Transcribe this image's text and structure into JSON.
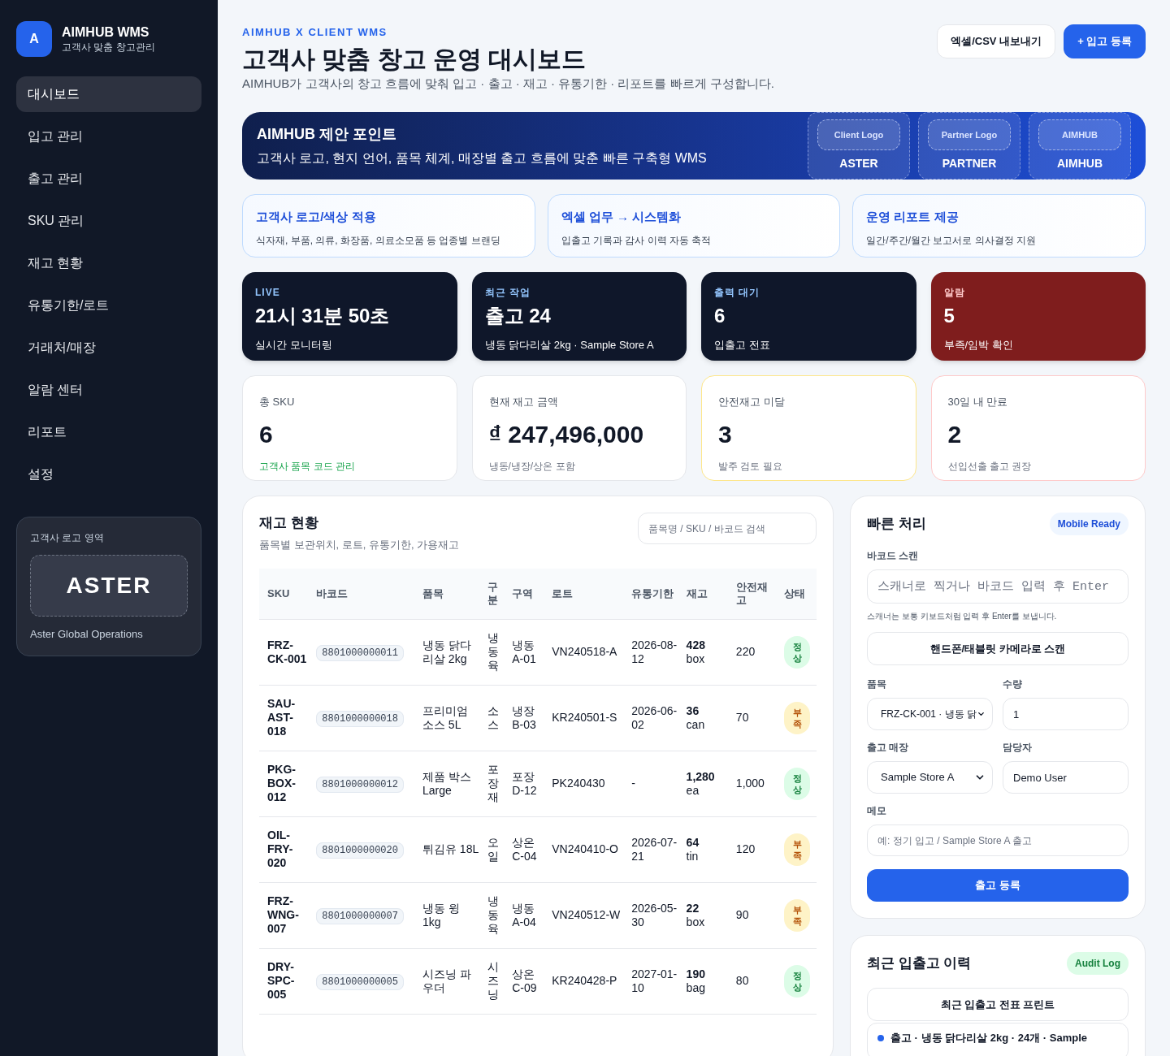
{
  "brand": {
    "mark": "A",
    "name": "AIMHUB WMS",
    "subtitle": "고객사 맞춤 창고관리"
  },
  "sidebar": {
    "items": [
      {
        "label": "대시보드",
        "selected": true
      },
      {
        "label": "입고 관리",
        "selected": false
      },
      {
        "label": "출고 관리",
        "selected": false
      },
      {
        "label": "SKU 관리",
        "selected": false
      },
      {
        "label": "재고 현황",
        "selected": false
      },
      {
        "label": "유통기한/로트",
        "selected": false
      },
      {
        "label": "거래처/매장",
        "selected": false
      },
      {
        "label": "알람 센터",
        "selected": false
      },
      {
        "label": "리포트",
        "selected": false
      },
      {
        "label": "설정",
        "selected": false
      }
    ],
    "logo_area": {
      "title": "고객사 로고 영역",
      "logo": "ASTER",
      "caption": "Aster Global Operations"
    }
  },
  "header": {
    "eyebrow": "AIMHUB X CLIENT WMS",
    "title": "고객사 맞춤 창고 운영 대시보드",
    "subtitle": "AIMHUB가 고객사의 창고 흐름에 맞춰 입고 · 출고 · 재고 · 유통기한 · 리포트를 빠르게 구성합니다.",
    "buttons": [
      {
        "label": "엑셀/CSV 내보내기",
        "kind": "secondary"
      },
      {
        "label": "+ 입고 등록",
        "kind": "primary"
      }
    ]
  },
  "banner": {
    "title": "AIMHUB 제안 포인트",
    "text": "고객사 로고, 현지 언어, 품목 체계, 매장별 출고 흐름에 맞춘 빠른 구축형 WMS",
    "logos": [
      {
        "tag": "Client Logo",
        "name": "ASTER"
      },
      {
        "tag": "Partner Logo",
        "name": "PARTNER"
      },
      {
        "tag": "AIMHUB",
        "name": "AIMHUB"
      }
    ]
  },
  "features": [
    {
      "title": "고객사 로고/색상 적용",
      "text": "식자재, 부품, 의류, 화장품, 의료소모품 등 업종별 브랜딩"
    },
    {
      "title": "엑셀 업무 → 시스템화",
      "text": "입출고 기록과 감사 이력 자동 축적"
    },
    {
      "title": "운영 리포트 제공",
      "text": "일간/주간/월간 보고서로 의사결정 지원"
    }
  ],
  "status_cards": [
    {
      "label": "LIVE",
      "value": "21시 31분 50초",
      "caption": "실시간 모니터링",
      "kind": "live"
    },
    {
      "label": "최근 작업",
      "value": "출고 24",
      "caption": "냉동 닭다리살 2kg · Sample Store A",
      "kind": "dark"
    },
    {
      "label": "출력 대기",
      "value": "6",
      "caption": "입출고 전표",
      "kind": "dark"
    },
    {
      "label": "알람",
      "value": "5",
      "caption": "부족/임박 확인",
      "kind": "alert"
    }
  ],
  "kpis": [
    {
      "label": "총 SKU",
      "value": "6",
      "caption": "고객사 품목 코드 관리",
      "kind": "good"
    },
    {
      "label": "현재 재고 금액",
      "value": "₫ 247,496,000",
      "caption": "냉동/냉장/상온 포함",
      "kind": "plain"
    },
    {
      "label": "안전재고 미달",
      "value": "3",
      "caption": "발주 검토 필요",
      "kind": "warning"
    },
    {
      "label": "30일 내 만료",
      "value": "2",
      "caption": "선입선출 출고 권장",
      "kind": "danger"
    }
  ],
  "inventory": {
    "title": "재고 현황",
    "subtitle": "품목별 보관위치, 로트, 유통기한, 가용재고",
    "search": {
      "placeholder": "품목명 / SKU / 바코드 검색"
    },
    "columns": [
      "SKU",
      "바코드",
      "품목",
      "구분",
      "구역",
      "로트",
      "유통기한",
      "재고",
      "안전재고",
      "상태"
    ],
    "rows": [
      {
        "sku": "FRZ-CK-001",
        "barcode": "8801000000011",
        "item": "냉동 닭다리살 2kg",
        "category": "냉동육",
        "zone": "냉동 A-01",
        "lot": "VN240518-A",
        "expiry": "2026-08-12",
        "stock": "428",
        "unit": "box",
        "safety": "220",
        "status": {
          "label": "정상",
          "kind": "ok"
        }
      },
      {
        "sku": "SAU-AST-018",
        "barcode": "8801000000018",
        "item": "프리미엄 소스 5L",
        "category": "소스",
        "zone": "냉장 B-03",
        "lot": "KR240501-S",
        "expiry": "2026-06-02",
        "stock": "36",
        "unit": "can",
        "safety": "70",
        "status": {
          "label": "부족",
          "kind": "low"
        }
      },
      {
        "sku": "PKG-BOX-012",
        "barcode": "8801000000012",
        "item": "제품 박스 Large",
        "category": "포장재",
        "zone": "포장 D-12",
        "lot": "PK240430",
        "expiry": "-",
        "stock": "1,280",
        "unit": "ea",
        "safety": "1,000",
        "status": {
          "label": "정상",
          "kind": "ok"
        }
      },
      {
        "sku": "OIL-FRY-020",
        "barcode": "8801000000020",
        "item": "튀김유 18L",
        "category": "오일",
        "zone": "상온 C-04",
        "lot": "VN240410-O",
        "expiry": "2026-07-21",
        "stock": "64",
        "unit": "tin",
        "safety": "120",
        "status": {
          "label": "부족",
          "kind": "low"
        }
      },
      {
        "sku": "FRZ-WNG-007",
        "barcode": "8801000000007",
        "item": "냉동 윙 1kg",
        "category": "냉동육",
        "zone": "냉동 A-04",
        "lot": "VN240512-W",
        "expiry": "2026-05-30",
        "stock": "22",
        "unit": "box",
        "safety": "90",
        "status": {
          "label": "부족",
          "kind": "low"
        }
      },
      {
        "sku": "DRY-SPC-005",
        "barcode": "8801000000005",
        "item": "시즈닝 파우더",
        "category": "시즈닝",
        "zone": "상온 C-09",
        "lot": "KR240428-P",
        "expiry": "2027-01-10",
        "stock": "190",
        "unit": "bag",
        "safety": "80",
        "status": {
          "label": "정상",
          "kind": "ok"
        }
      }
    ]
  },
  "quick": {
    "title": "빠른 처리",
    "badge": "Mobile Ready",
    "scan_label": "바코드 스캔",
    "scan": {
      "placeholder": "스캐너로 찍거나 바코드 입력 후 Enter"
    },
    "scan_hint": "스캐너는 보통 키보드처럼 입력 후 Enter를 보냅니다.",
    "camera_button": "핸드폰/태블릿 카메라로 스캔",
    "item_label": "품목",
    "item_value": "FRZ-CK-001 · 냉동 닭",
    "qty_label": "수량",
    "qty_value": "1",
    "store_label": "출고 매장",
    "store_value": "Sample Store A",
    "user_label": "담당자",
    "user_value": "Demo User",
    "memo_label": "메모",
    "memo": {
      "placeholder": "예: 정기 입고 / Sample Store A 출고"
    },
    "submit": "출고 등록"
  },
  "history": {
    "title": "최근 입출고 이력",
    "badge": "Audit Log",
    "print_button": "최근 입출고 전표 프린트",
    "entries": [
      {
        "text": "출고 · 냉동 닭다리살 2kg · 24개 · Sample"
      }
    ]
  }
}
